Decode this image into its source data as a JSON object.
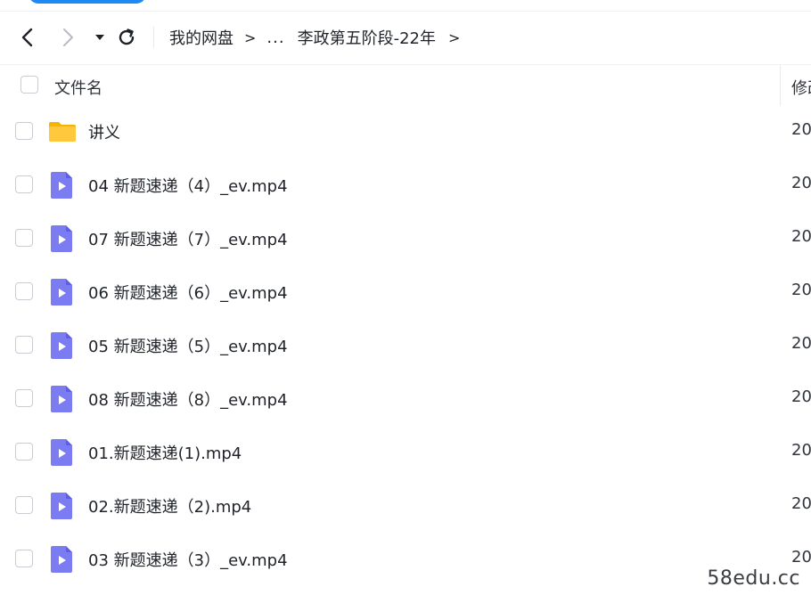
{
  "nav": {
    "back_icon": "chevron-left-icon",
    "forward_icon": "chevron-right-icon",
    "history_icon": "caret-down-icon",
    "refresh_icon": "refresh-icon"
  },
  "breadcrumb": {
    "root": "我的网盘",
    "separator": ">",
    "ellipsis": "...",
    "current": "李政第五阶段-22年"
  },
  "header": {
    "name_label": "文件名",
    "modified_label": "修改"
  },
  "files": [
    {
      "name": "讲义",
      "type": "folder",
      "date": "20"
    },
    {
      "name": "04 新题速递（4）_ev.mp4",
      "type": "video",
      "date": "20"
    },
    {
      "name": "07 新题速递（7）_ev.mp4",
      "type": "video",
      "date": "20"
    },
    {
      "name": "06 新题速递（6）_ev.mp4",
      "type": "video",
      "date": "20"
    },
    {
      "name": "05 新题速递（5）_ev.mp4",
      "type": "video",
      "date": "20"
    },
    {
      "name": "08 新题速递（8）_ev.mp4",
      "type": "video",
      "date": "20"
    },
    {
      "name": "01.新题速递(1).mp4",
      "type": "video",
      "date": "20"
    },
    {
      "name": "02.新题速递（2).mp4",
      "type": "video",
      "date": "20"
    },
    {
      "name": "03 新题速递（3）_ev.mp4",
      "type": "video",
      "date": "20"
    }
  ],
  "watermark": "58edu.cc",
  "colors": {
    "folder": "#ffc83d",
    "folder_tab": "#f5b400",
    "video_icon": "#7b7cf2",
    "video_icon_dark": "#5d5ee0",
    "accent": "#1e88f5"
  }
}
